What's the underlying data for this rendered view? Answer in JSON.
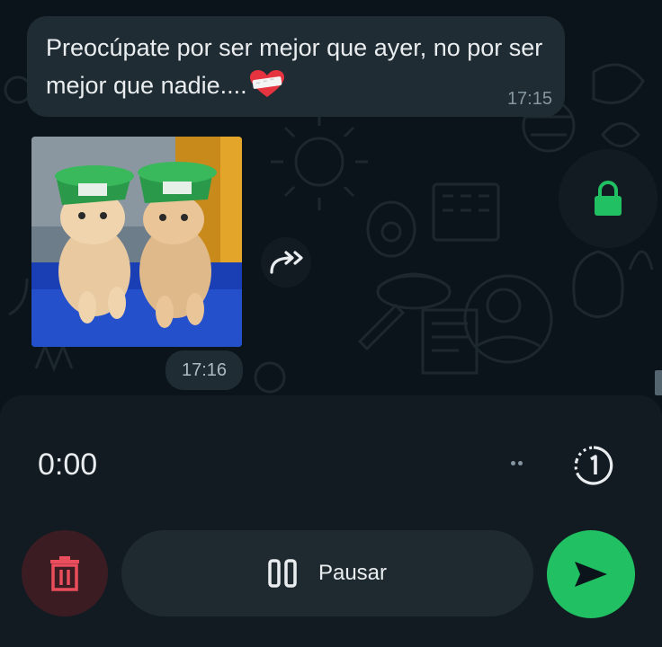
{
  "colors": {
    "background": "#0b141a",
    "bubble": "#202c33",
    "accent_green": "#21c063",
    "delete_red": "#ea4d5b"
  },
  "chat": {
    "message": {
      "text": "Preocúpate por ser mejor que ayer, no por ser mejor que nadie....",
      "emoji": "heart-with-bandage",
      "time": "17:15"
    },
    "media_message": {
      "type": "sticker-image",
      "time": "17:16"
    },
    "forward_icon": "forward-icon",
    "lock_icon": "lock-icon"
  },
  "recorder": {
    "timer": "0:00",
    "view_once_icon": "view-once-icon",
    "delete_icon": "trash-icon",
    "pause_label": "Pausar",
    "pause_icon": "pause-icon",
    "send_icon": "send-icon"
  }
}
